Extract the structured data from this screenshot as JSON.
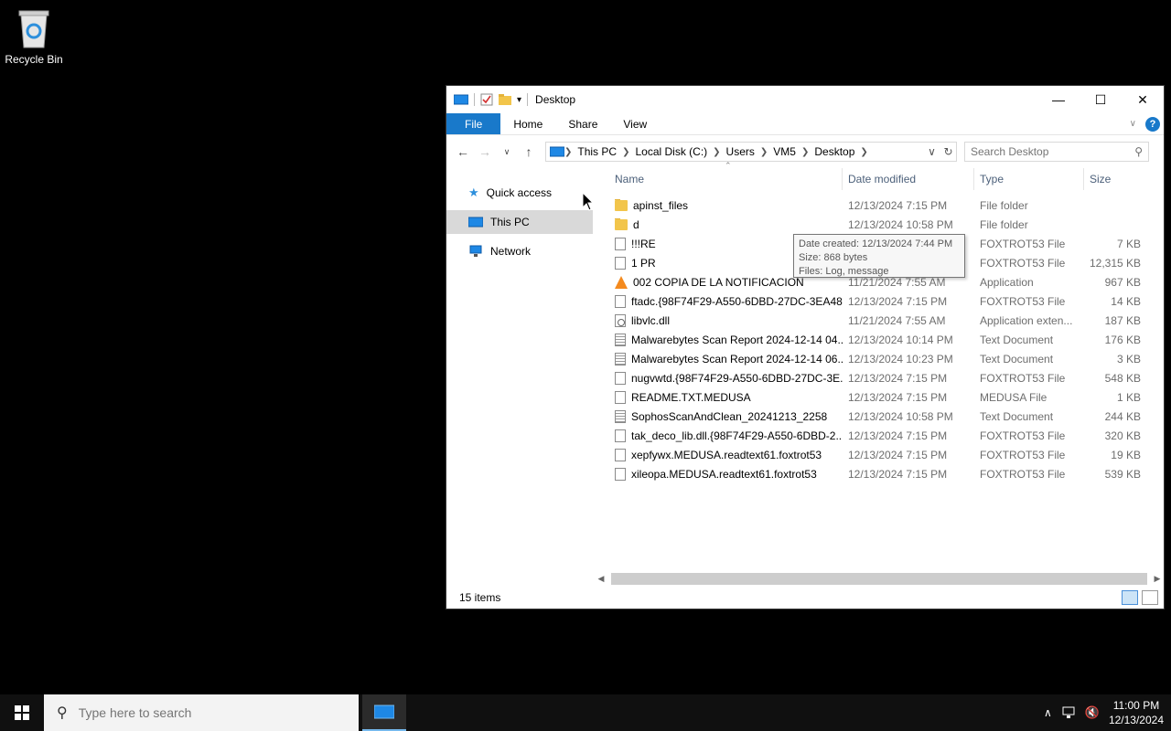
{
  "desktop": {
    "icons": [
      {
        "label": "Recycle Bin"
      }
    ]
  },
  "window": {
    "title": "Desktop",
    "ribbon": {
      "tabs": [
        "File",
        "Home",
        "Share",
        "View"
      ]
    },
    "nav": {
      "address": [
        "This PC",
        "Local Disk (C:)",
        "Users",
        "VM5",
        "Desktop"
      ],
      "search_placeholder": "Search Desktop"
    },
    "navpane": [
      {
        "label": "Quick access",
        "icon": "star-icon"
      },
      {
        "label": "This PC",
        "icon": "pc-icon",
        "selected": true
      },
      {
        "label": "Network",
        "icon": "network-icon"
      }
    ],
    "columns": [
      "Name",
      "Date modified",
      "Type",
      "Size"
    ],
    "files": [
      {
        "name": "apinst_files",
        "date": "12/13/2024 7:15 PM",
        "type": "File folder",
        "size": "",
        "icon": "folder-icon"
      },
      {
        "name": "d",
        "date": "12/13/2024 10:58 PM",
        "type": "File folder",
        "size": "",
        "icon": "folder-icon"
      },
      {
        "name": "!!!RE",
        "date": "12/13/2024 7:15 PM",
        "type": "FOXTROT53 File",
        "size": "7 KB",
        "icon": "file-icon"
      },
      {
        "name": "1 PR",
        "date": "12/13/2024 7:15 PM",
        "type": "FOXTROT53 File",
        "size": "12,315 KB",
        "icon": "file-icon"
      },
      {
        "name": "002 COPIA DE LA NOTIFICACION",
        "date": "11/21/2024 7:55 AM",
        "type": "Application",
        "size": "967 KB",
        "icon": "vlc-icon"
      },
      {
        "name": "ftadc.{98F74F29-A550-6DBD-27DC-3EA48...",
        "date": "12/13/2024 7:15 PM",
        "type": "FOXTROT53 File",
        "size": "14 KB",
        "icon": "file-icon"
      },
      {
        "name": "libvlc.dll",
        "date": "11/21/2024 7:55 AM",
        "type": "Application exten...",
        "size": "187 KB",
        "icon": "dll-icon"
      },
      {
        "name": "Malwarebytes Scan Report 2024-12-14 04...",
        "date": "12/13/2024 10:14 PM",
        "type": "Text Document",
        "size": "176 KB",
        "icon": "text-icon"
      },
      {
        "name": "Malwarebytes Scan Report 2024-12-14 06...",
        "date": "12/13/2024 10:23 PM",
        "type": "Text Document",
        "size": "3 KB",
        "icon": "text-icon"
      },
      {
        "name": "nugvwtd.{98F74F29-A550-6DBD-27DC-3E...",
        "date": "12/13/2024 7:15 PM",
        "type": "FOXTROT53 File",
        "size": "548 KB",
        "icon": "file-icon"
      },
      {
        "name": "README.TXT.MEDUSA",
        "date": "12/13/2024 7:15 PM",
        "type": "MEDUSA File",
        "size": "1 KB",
        "icon": "file-icon"
      },
      {
        "name": "SophosScanAndClean_20241213_2258",
        "date": "12/13/2024 10:58 PM",
        "type": "Text Document",
        "size": "244 KB",
        "icon": "text-icon"
      },
      {
        "name": "tak_deco_lib.dll.{98F74F29-A550-6DBD-2...",
        "date": "12/13/2024 7:15 PM",
        "type": "FOXTROT53 File",
        "size": "320 KB",
        "icon": "file-icon"
      },
      {
        "name": "xepfywx.MEDUSA.readtext61.foxtrot53",
        "date": "12/13/2024 7:15 PM",
        "type": "FOXTROT53 File",
        "size": "19 KB",
        "icon": "file-icon"
      },
      {
        "name": "xileopa.MEDUSA.readtext61.foxtrot53",
        "date": "12/13/2024 7:15 PM",
        "type": "FOXTROT53 File",
        "size": "539 KB",
        "icon": "file-icon"
      }
    ],
    "tooltip": {
      "line1": "Date created: 12/13/2024 7:44 PM",
      "line2": "Size: 868 bytes",
      "line3": "Files: Log, message"
    },
    "status": "15 items"
  },
  "taskbar": {
    "search_placeholder": "Type here to search",
    "time": "11:00 PM",
    "date": "12/13/2024"
  }
}
